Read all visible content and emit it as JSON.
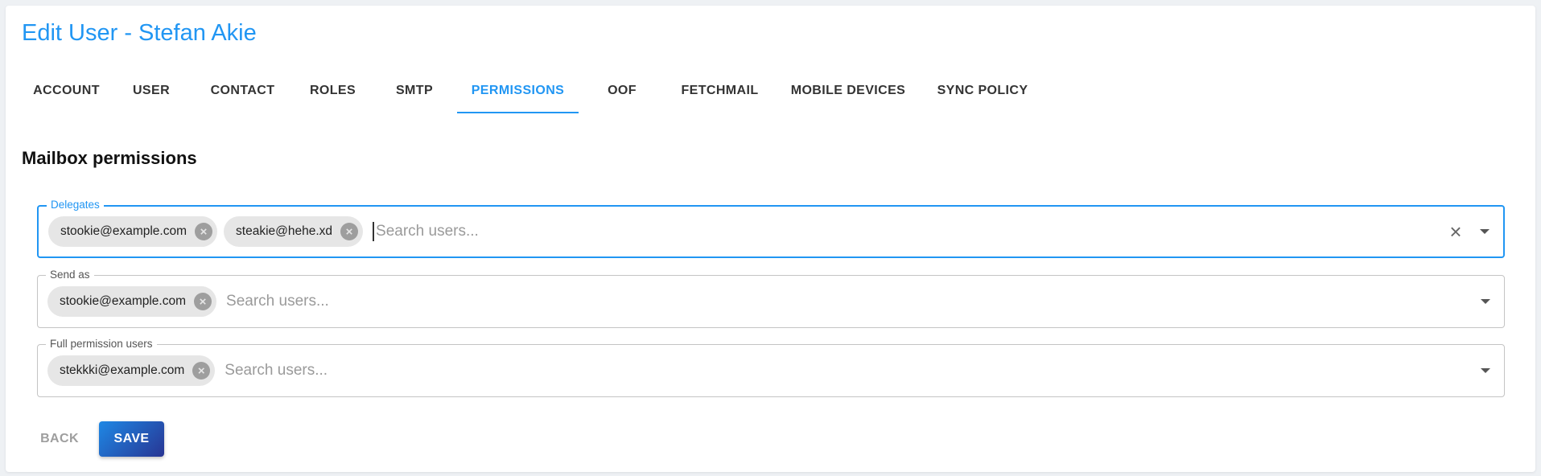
{
  "page": {
    "title": "Edit User - Stefan Akie"
  },
  "tabs": [
    {
      "label": "ACCOUNT"
    },
    {
      "label": "USER"
    },
    {
      "label": "CONTACT"
    },
    {
      "label": "ROLES"
    },
    {
      "label": "SMTP"
    },
    {
      "label": "PERMISSIONS",
      "active": true
    },
    {
      "label": "OOF"
    },
    {
      "label": "FETCHMAIL"
    },
    {
      "label": "MOBILE DEVICES"
    },
    {
      "label": "SYNC POLICY"
    }
  ],
  "section": {
    "title": "Mailbox permissions"
  },
  "fields": {
    "delegates": {
      "label": "Delegates",
      "chips": [
        "stookie@example.com",
        "steakie@hehe.xd"
      ],
      "placeholder": "Search users...",
      "focused": true
    },
    "send_as": {
      "label": "Send as",
      "chips": [
        "stookie@example.com"
      ],
      "placeholder": "Search users..."
    },
    "full_permission": {
      "label": "Full permission users",
      "chips": [
        "stekkki@example.com"
      ],
      "placeholder": "Search users..."
    }
  },
  "icons": {
    "chip_remove": "close-circle-icon",
    "clear": "close-icon",
    "dropdown": "arrow-drop-down-icon"
  },
  "buttons": {
    "back": "BACK",
    "save": "SAVE"
  },
  "colors": {
    "accent": "#2196f3",
    "save_gradient_start": "#1e88e5",
    "save_gradient_end": "#283593"
  }
}
